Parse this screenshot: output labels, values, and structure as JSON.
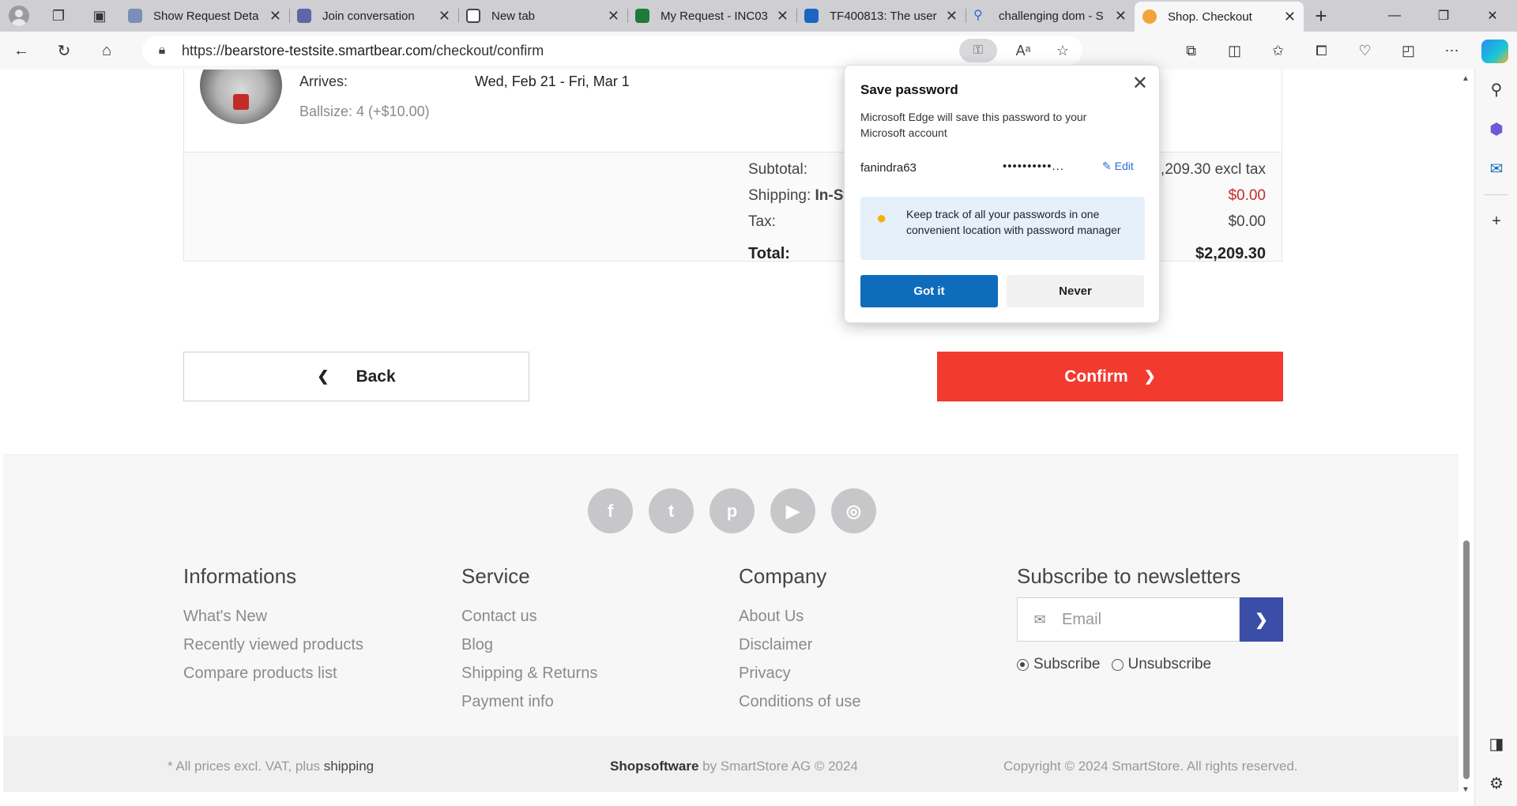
{
  "browser": {
    "tabs": [
      {
        "title": "Show Request Deta",
        "color": "#7a8fb5"
      },
      {
        "title": "Join conversation",
        "color": "#6264a7"
      },
      {
        "title": "New tab",
        "color": "#444444"
      },
      {
        "title": "My Request - INC03",
        "color": "#1d7a3a"
      },
      {
        "title": "TF400813: The user",
        "color": "#1a66c2"
      },
      {
        "title": "challenging dom - S",
        "color": "#2a6fd6"
      },
      {
        "title": "Shop. Checkout",
        "color": "#f2a33a"
      }
    ],
    "url_prefix": "https://",
    "url_host": "bearstore-testsite.smartbear.com",
    "url_path": "/checkout/confirm"
  },
  "cart": {
    "arrives_label": "Arrives:",
    "arrives_value": "Wed, Feb 21 - Fri, Mar 1",
    "ballsize": "Ballsize: 4 (+$10.00)",
    "subtotal_label": "Subtotal:",
    "subtotal_value": "2,209.30 excl tax",
    "shipping_label": "Shipping: ",
    "shipping_method": "In-St",
    "shipping_value": "$0.00",
    "tax_label": "Tax:",
    "tax_value": "$0.00",
    "total_label": "Total:",
    "total_value": "$2,209.30"
  },
  "actions": {
    "back_label": "Back",
    "confirm_label": "Confirm"
  },
  "footer": {
    "socials": [
      "facebook-icon",
      "twitter-icon",
      "pinterest-icon",
      "youtube-icon",
      "instagram-icon"
    ],
    "informations": {
      "title": "Informations",
      "links": [
        "What's New",
        "Recently viewed products",
        "Compare products list"
      ]
    },
    "service": {
      "title": "Service",
      "links": [
        "Contact us",
        "Blog",
        "Shipping & Returns",
        "Payment info"
      ]
    },
    "company": {
      "title": "Company",
      "links": [
        "About Us",
        "Disclaimer",
        "Privacy",
        "Conditions of use"
      ]
    },
    "newsletter": {
      "title": "Subscribe to newsletters",
      "placeholder": "Email",
      "subscribe": "Subscribe",
      "unsubscribe": "Unsubscribe"
    },
    "bottom_left_prefix": "* All prices excl. VAT, plus ",
    "bottom_left_link": "shipping",
    "bottom_center_brand": "Shopsoftware",
    "bottom_center_rest": " by SmartStore AG © 2024",
    "bottom_right": "Copyright © 2024 SmartStore. All rights reserved."
  },
  "popup": {
    "title": "Save password",
    "description": "Microsoft Edge will save this password to your Microsoft account",
    "username": "fanindra63",
    "password_mask": "••••••••••...",
    "edit_label": "Edit",
    "tip": "Keep track of all your passwords in one convenient location with password manager",
    "got_it": "Got it",
    "never": "Never"
  },
  "colors": {
    "confirm": "#f23a2f",
    "newsletter_button": "#3a4ea8",
    "popup_primary": "#0f6cbd",
    "shipping_price": "#c62a2a"
  }
}
